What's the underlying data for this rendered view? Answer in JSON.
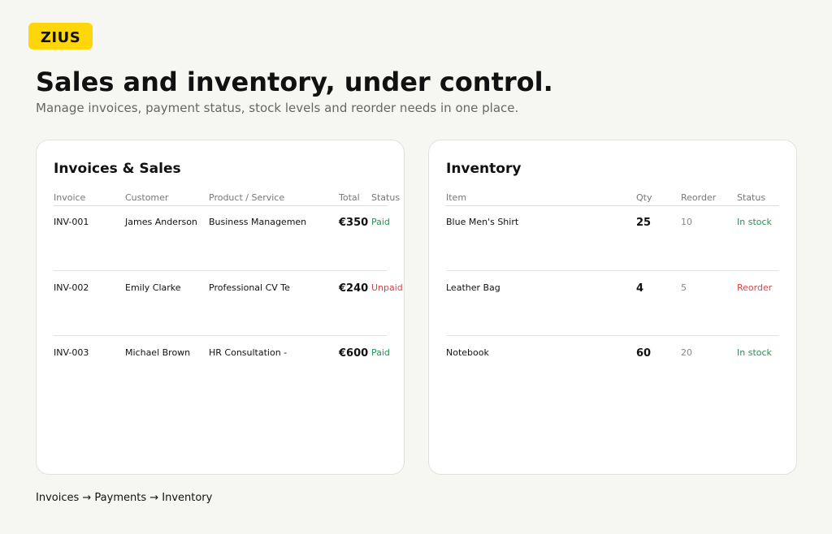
{
  "brand": {
    "logo_text": "ZIUS",
    "accent": "#ffd60a"
  },
  "hero": {
    "title": "Sales and inventory, under control.",
    "subtitle": "Manage invoices, payment status, stock levels and reorder needs in one place."
  },
  "invoices": {
    "title": "Invoices & Sales",
    "headers": {
      "invoice": "Invoice",
      "customer": "Customer",
      "product": "Product / Service",
      "total": "Total",
      "status": "Status"
    },
    "rows": [
      {
        "invoice": "INV-001",
        "customer": "James Anderson",
        "product": "Business Managemen",
        "total": "€350",
        "status": "Paid"
      },
      {
        "invoice": "INV-002",
        "customer": "Emily Clarke",
        "product": "Professional CV Te",
        "total": "€240",
        "status": "Unpaid"
      },
      {
        "invoice": "INV-003",
        "customer": "Michael Brown",
        "product": "HR Consultation -",
        "total": "€600",
        "status": "Paid"
      }
    ]
  },
  "inventory": {
    "title": "Inventory",
    "headers": {
      "item": "Item",
      "qty": "Qty",
      "reorder": "Reorder",
      "status": "Status"
    },
    "rows": [
      {
        "item": "Blue Men's Shirt",
        "qty": "25",
        "reorder": "10",
        "status": "In stock"
      },
      {
        "item": "Leather Bag",
        "qty": "4",
        "reorder": "5",
        "status": "Reorder"
      },
      {
        "item": "Notebook",
        "qty": "60",
        "reorder": "20",
        "status": "In stock"
      }
    ]
  },
  "colors": {
    "status_good": "#2e8b57",
    "status_bad": "#d64545"
  },
  "footer": {
    "flow": "Invoices → Payments → Inventory"
  }
}
